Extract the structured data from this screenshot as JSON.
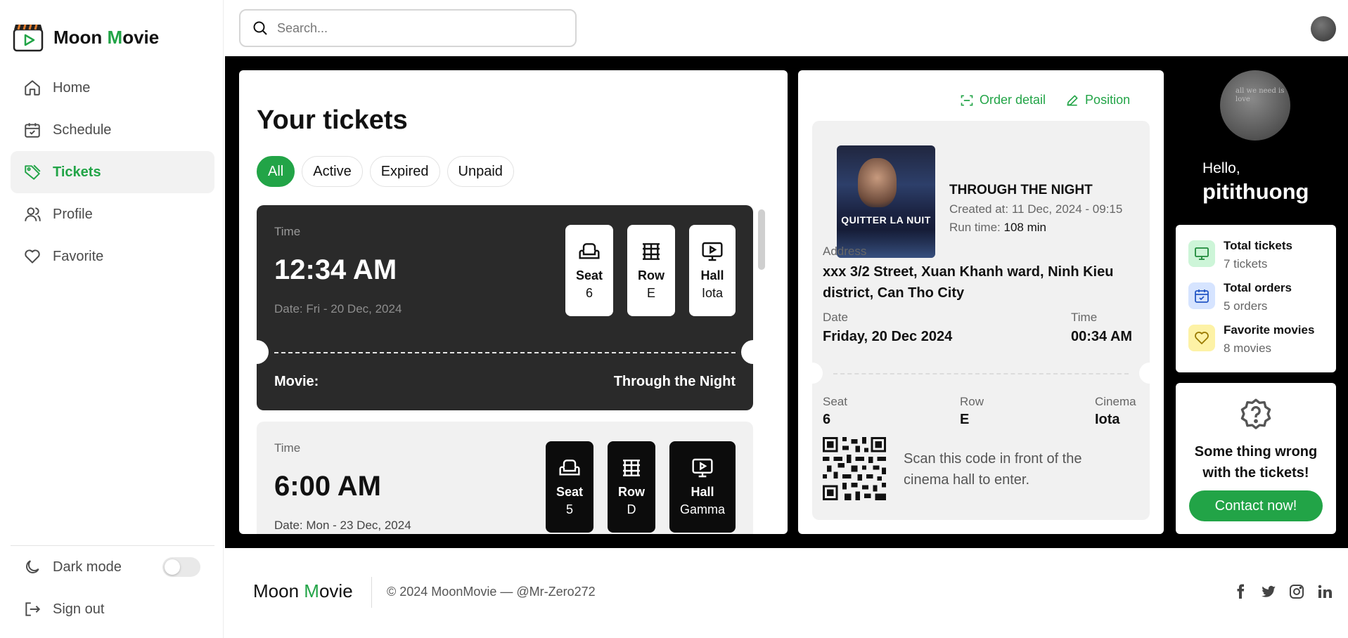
{
  "brand": {
    "first": "Moon",
    "m": "M",
    "rest": "ovie"
  },
  "nav": {
    "items": [
      {
        "label": "Home",
        "icon": "home-icon"
      },
      {
        "label": "Schedule",
        "icon": "calendar-icon"
      },
      {
        "label": "Tickets",
        "icon": "tag-icon",
        "active": true
      },
      {
        "label": "Profile",
        "icon": "user-icon"
      },
      {
        "label": "Favorite",
        "icon": "heart-icon"
      }
    ],
    "dark_mode": "Dark mode",
    "dark_mode_on": false,
    "sign_out": "Sign out"
  },
  "search": {
    "placeholder": "Search..."
  },
  "tickets": {
    "title": "Your tickets",
    "filters": [
      "All",
      "Active",
      "Expired",
      "Unpaid"
    ],
    "active_filter": "All",
    "list": [
      {
        "time_label": "Time",
        "time": "12:34 AM",
        "date": "Date: Fri - 20 Dec, 2024",
        "seat_label": "Seat",
        "seat": "6",
        "row_label": "Row",
        "row": "E",
        "hall_label": "Hall",
        "hall": "Iota",
        "movie_label": "Movie:",
        "movie": "Through the Night"
      },
      {
        "time_label": "Time",
        "time": "6:00 AM",
        "date": "Date: Mon - 23 Dec, 2024",
        "seat_label": "Seat",
        "seat": "5",
        "row_label": "Row",
        "row": "D",
        "hall_label": "Hall",
        "hall": "Gamma"
      }
    ]
  },
  "detail": {
    "order_detail": "Order detail",
    "position": "Position",
    "poster_title": "QUITTER LA NUIT",
    "movie_title": "THROUGH THE NIGHT",
    "created": "Created at: 11 Dec, 2024 - 09:15",
    "run_label": "Run time: ",
    "run_time": "108 min",
    "address_label": "Address",
    "address": "xxx 3/2 Street, Xuan Khanh ward, Ninh Kieu district, Can Tho City",
    "date_label": "Date",
    "date": "Friday, 20 Dec 2024",
    "time_label": "Time",
    "time": "00:34 AM",
    "seat_label": "Seat",
    "seat": "6",
    "row_label": "Row",
    "row": "E",
    "cinema_label": "Cinema",
    "cinema": "Iota",
    "scan_text": "Scan this code in front of the cinema hall to enter."
  },
  "user": {
    "avatar_text": "all we need is love",
    "hello": "Hello,",
    "name": "pitithuong",
    "stats": [
      {
        "title": "Total tickets",
        "value": "7 tickets",
        "icon": "monitor-icon",
        "color": "#cdf5d8"
      },
      {
        "title": "Total orders",
        "value": "5 orders",
        "icon": "calendar-check-icon",
        "color": "#d6e4ff"
      },
      {
        "title": "Favorite movies",
        "value": "8 movies",
        "icon": "heart-icon",
        "color": "#fdf2a6"
      }
    ],
    "help_text": "Some thing wrong with the tickets!",
    "contact": "Contact now!"
  },
  "footer": {
    "brand_first": "Moon",
    "brand_m": "M",
    "brand_rest": "ovie",
    "copyright": "© 2024 MoonMovie — @Mr-Zero272",
    "socials": [
      "facebook-icon",
      "twitter-icon",
      "instagram-icon",
      "linkedin-icon"
    ]
  },
  "colors": {
    "accent": "#22a447",
    "dark_ticket": "#2a2a2a",
    "panel_bg": "#000000"
  }
}
